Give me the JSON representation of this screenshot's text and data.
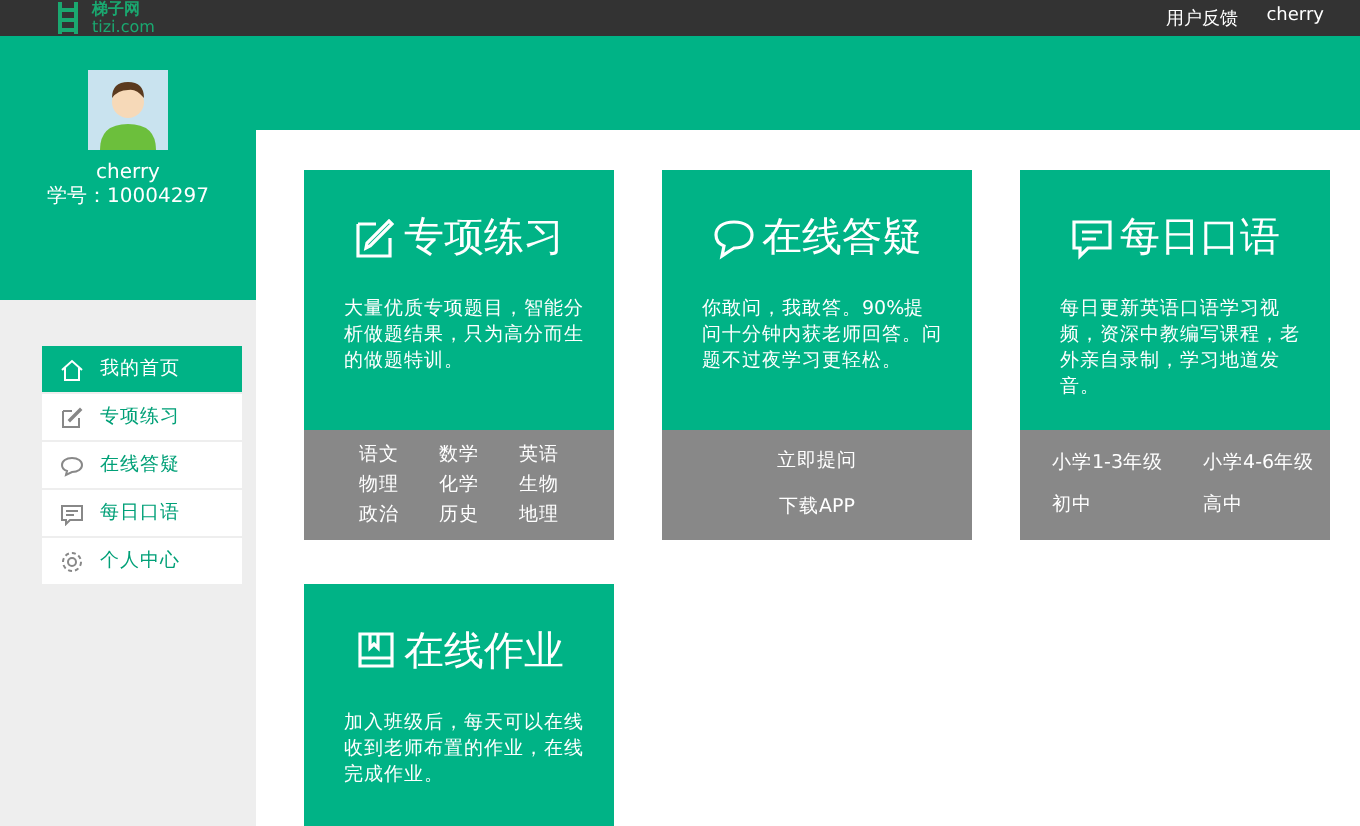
{
  "header": {
    "logo_title": "梯子网",
    "logo_domain": "tizi.com",
    "links": [
      "用户反馈",
      "cherry"
    ]
  },
  "profile": {
    "name": "cherry",
    "student_id": "学号：10004297"
  },
  "sidebar": {
    "items": [
      {
        "label": "我的首页",
        "kind": "home",
        "selected": true
      },
      {
        "label": "专项练习",
        "kind": "pencil",
        "selected": false
      },
      {
        "label": "在线答疑",
        "kind": "chat",
        "selected": false
      },
      {
        "label": "每日口语",
        "kind": "message",
        "selected": false
      },
      {
        "label": "个人中心",
        "kind": "gear",
        "selected": false
      }
    ]
  },
  "cards": [
    {
      "kind": "pencil",
      "title": "专项练习",
      "description": "大量优质专项题目，智能分析做题结果，只为高分而生的做题特训。",
      "links": [
        "语文",
        "数学",
        "英语",
        "物理",
        "化学",
        "生物",
        "政治",
        "历史",
        "地理"
      ]
    },
    {
      "kind": "chat",
      "title": "在线答疑",
      "description": "你敢问，我敢答。90%提问十分钟内获老师回答。问题不过夜学习更轻松。",
      "links": [
        "立即提问",
        "下载APP"
      ]
    },
    {
      "kind": "message",
      "title": "每日口语",
      "description": "每日更新英语口语学习视频，资深中教编写课程，老外亲自录制，学习地道发音。",
      "links": [
        "小学1-3年级",
        "小学4-6年级",
        "初中",
        "高中"
      ]
    },
    {
      "kind": "book",
      "title": "在线作业",
      "description": "加入班级后，每天可以在线收到老师布置的作业，在线完成作业。"
    }
  ]
}
